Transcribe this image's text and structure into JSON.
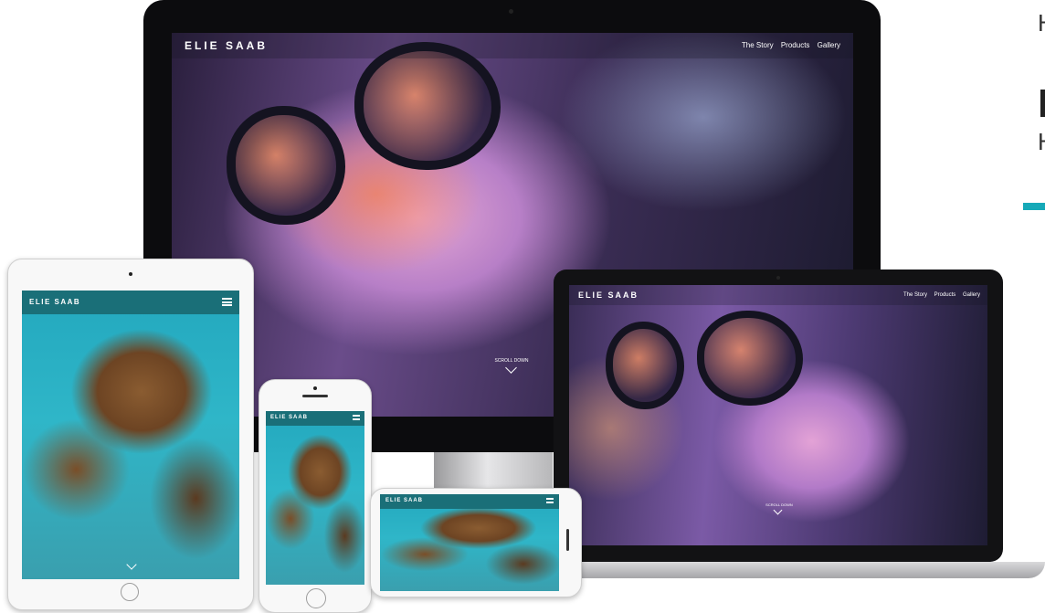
{
  "brand": "ELIE SAAB",
  "desktop_nav": [
    "The Story",
    "Products",
    "Gallery"
  ],
  "laptop_nav": [
    "The Story",
    "Products",
    "Gallery"
  ],
  "scroll_label": "SCROLL DOWN",
  "icons": {
    "menu": "hamburger-menu-icon",
    "scroll": "chevron-down-icon",
    "home": "home-button-icon"
  },
  "colors": {
    "accent": "#16a9b8",
    "mobile_header": "#1a6f78"
  }
}
